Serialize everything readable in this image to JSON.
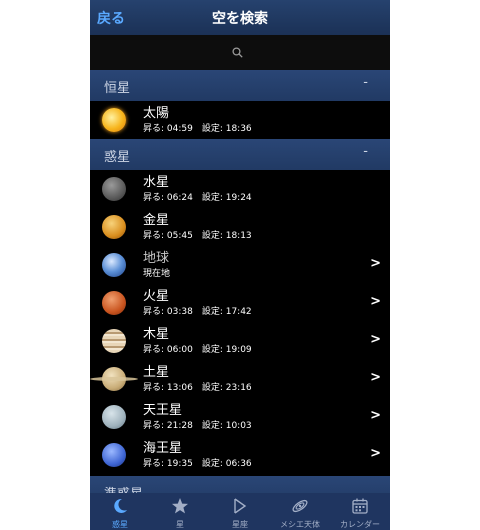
{
  "header": {
    "back_label": "戻る",
    "title": "空を検索"
  },
  "search": {
    "placeholder": ""
  },
  "sections": {
    "stars": {
      "label": "恒星",
      "toggle": "-"
    },
    "planets": {
      "label": "惑星",
      "toggle": "-"
    },
    "dwarf": {
      "label": "準惑星"
    }
  },
  "stars": [
    {
      "name": "太陽",
      "times": "昇る: 04:59　設定: 18:36",
      "icon": "sun-icon"
    }
  ],
  "planets": [
    {
      "name": "水星",
      "times": "昇る: 06:24　設定: 19:24",
      "icon": "mercury-icon"
    },
    {
      "name": "金星",
      "times": "昇る: 05:45　設定: 18:13",
      "icon": "venus-icon"
    },
    {
      "name": "地球",
      "times": "現在地",
      "icon": "earth-icon",
      "chevron": ">"
    },
    {
      "name": "火星",
      "times": "昇る: 03:38　設定: 17:42",
      "icon": "mars-icon",
      "chevron": ">"
    },
    {
      "name": "木星",
      "times": "昇る: 06:00　設定: 19:09",
      "icon": "jupiter-icon",
      "chevron": ">"
    },
    {
      "name": "土星",
      "times": "昇る: 13:06　設定: 23:16",
      "icon": "saturn-icon",
      "chevron": ">"
    },
    {
      "name": "天王星",
      "times": "昇る: 21:28　設定: 10:03",
      "icon": "uranus-icon",
      "chevron": ">"
    },
    {
      "name": "海王星",
      "times": "昇る: 19:35　設定: 06:36",
      "icon": "neptune-icon",
      "chevron": ">"
    }
  ],
  "tabs": [
    {
      "label": "惑星",
      "icon": "moon-icon",
      "active": true
    },
    {
      "label": "星",
      "icon": "star-icon"
    },
    {
      "label": "星座",
      "icon": "constellation-icon"
    },
    {
      "label": "メシエ天体",
      "icon": "galaxy-icon"
    },
    {
      "label": "カレンダー",
      "icon": "calendar-icon"
    }
  ],
  "colors": {
    "accent": "#5aa9ff",
    "navbar": "#1f3560",
    "section": "#243e6a",
    "background": "#000000"
  }
}
